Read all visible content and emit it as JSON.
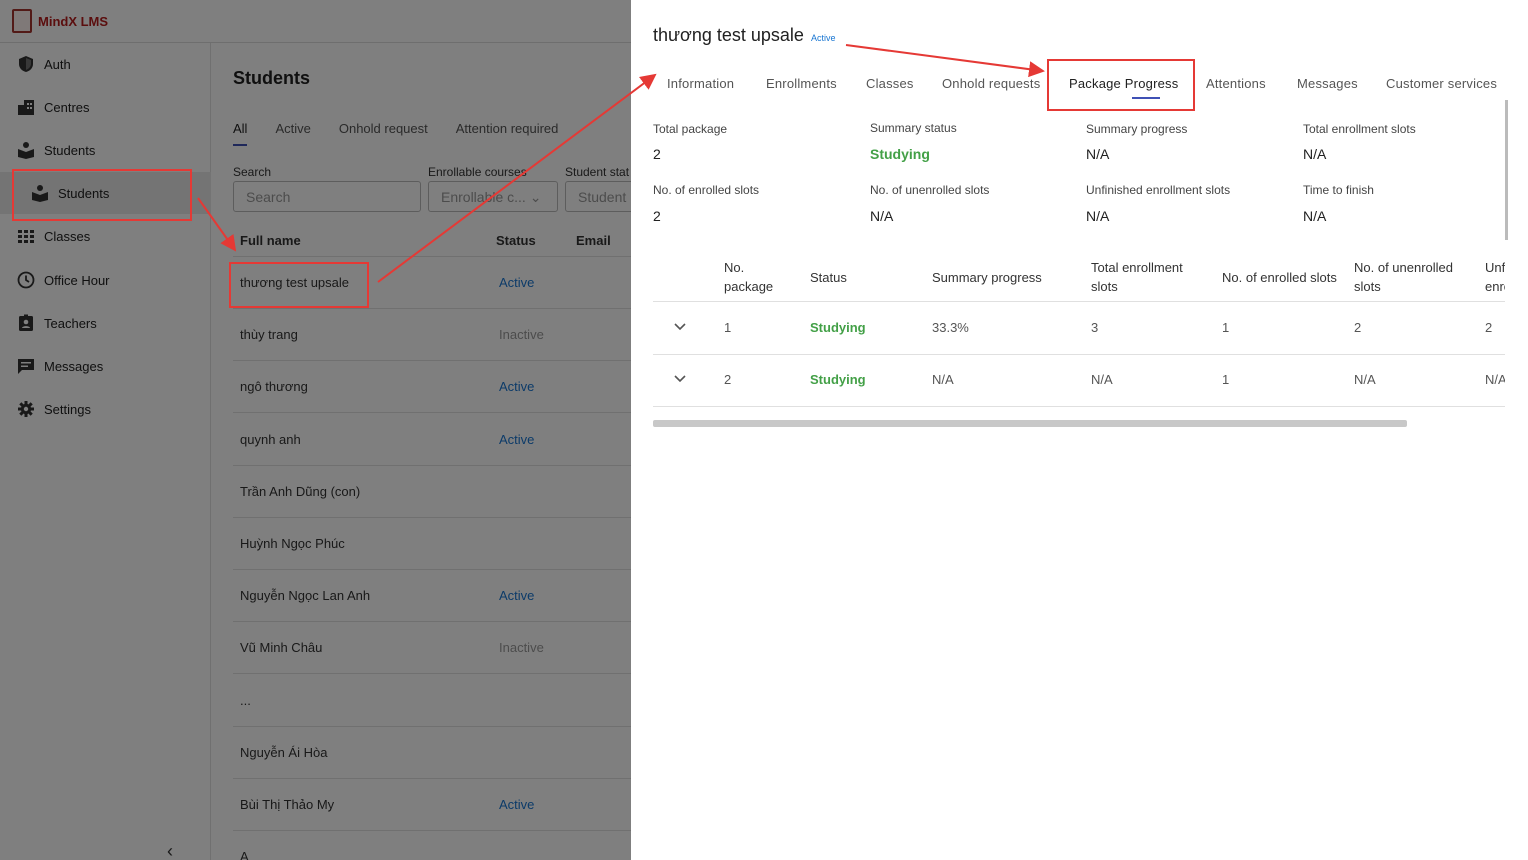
{
  "app": {
    "logo_text": "MindX LMS"
  },
  "sidebar": {
    "items": [
      {
        "label": "Auth",
        "icon": "shield-icon"
      },
      {
        "label": "Centres",
        "icon": "building-icon"
      },
      {
        "label": "Students",
        "icon": "student-icon"
      },
      {
        "label": "Students",
        "icon": "student-icon"
      },
      {
        "label": "Classes",
        "icon": "grid-icon"
      },
      {
        "label": "Office Hour",
        "icon": "clock-icon"
      },
      {
        "label": "Teachers",
        "icon": "badge-icon"
      },
      {
        "label": "Messages",
        "icon": "message-icon"
      },
      {
        "label": "Settings",
        "icon": "gear-icon"
      }
    ],
    "collapse": "‹"
  },
  "students_page": {
    "title": "Students",
    "tabs": [
      "All",
      "Active",
      "Onhold request",
      "Attention required"
    ],
    "filters": {
      "search_label": "Search",
      "search_placeholder": "Search",
      "courses_label": "Enrollable courses",
      "courses_placeholder": "Enrollable c...",
      "status_label": "Student stat",
      "status_placeholder": "Student"
    },
    "columns": {
      "name": "Full name",
      "status": "Status",
      "email": "Email"
    },
    "rows": [
      {
        "name": "thương test upsale",
        "status": "Active"
      },
      {
        "name": "thùy trang",
        "status": "Inactive"
      },
      {
        "name": "ngô thương",
        "status": "Active"
      },
      {
        "name": "quynh anh",
        "status": "Active"
      },
      {
        "name": "Trần Anh Dũng (con)",
        "status": ""
      },
      {
        "name": "Huỳnh Ngọc Phúc",
        "status": ""
      },
      {
        "name": "Nguyễn Ngọc Lan Anh",
        "status": "Active"
      },
      {
        "name": "Vũ Minh Châu",
        "status": "Inactive"
      },
      {
        "name": "...",
        "status": ""
      },
      {
        "name": "Nguyễn Ái Hòa",
        "status": ""
      },
      {
        "name": "Bùi Thị Thảo My",
        "status": "Active"
      },
      {
        "name": "A",
        "status": ""
      }
    ]
  },
  "drawer": {
    "title": "thương test upsale",
    "badge": "Active",
    "tabs": [
      "Information",
      "Enrollments",
      "Classes",
      "Onhold requests",
      "Package Progress",
      "Attentions",
      "Messages",
      "Customer services"
    ],
    "active_tab": "Package Progress",
    "summary": [
      {
        "label": "Total package",
        "value": "2"
      },
      {
        "label": "Summary status",
        "value": "Studying"
      },
      {
        "label": "Summary progress",
        "value": "N/A"
      },
      {
        "label": "Total enrollment slots",
        "value": "N/A"
      },
      {
        "label": "No. of enrolled slots",
        "value": "2"
      },
      {
        "label": "No. of unenrolled slots",
        "value": "N/A"
      },
      {
        "label": "Unfinished enrollment slots",
        "value": "N/A"
      },
      {
        "label": "Time to finish",
        "value": "N/A"
      }
    ],
    "table": {
      "headers": [
        "No. package",
        "Status",
        "Summary progress",
        "Total enrollment slots",
        "No. of enrolled slots",
        "No. of unenrolled slots",
        "Unfinished enrollment slots"
      ],
      "header_lines": {
        "no_package_1": "No.",
        "no_package_2": "package",
        "total_1": "Total enrollment",
        "total_2": "slots",
        "unenrolled_1": "No. of unenrolled",
        "unenrolled_2": "slots",
        "unfinished_1": "Unfinished",
        "unfinished_2": "enrollment"
      },
      "rows": [
        {
          "no": "1",
          "status": "Studying",
          "progress": "33.3%",
          "total": "3",
          "enrolled": "1",
          "unenrolled": "2",
          "unfinished": "2"
        },
        {
          "no": "2",
          "status": "Studying",
          "progress": "N/A",
          "total": "N/A",
          "enrolled": "1",
          "unenrolled": "N/A",
          "unfinished": "N/A"
        }
      ]
    }
  },
  "colors": {
    "accent": "#3f51b5",
    "annotation": "#e53935",
    "studying": "#43a047",
    "active_status": "#1976d2"
  }
}
